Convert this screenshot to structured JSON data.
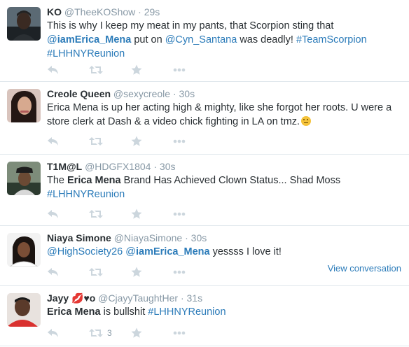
{
  "tweets": [
    {
      "fullname": "KO",
      "username": "@TheeKOShow",
      "time": "29s",
      "text_parts": [
        {
          "t": "This is why I keep my meat in my pants, that Scorpion sting that ",
          "s": "plain"
        },
        {
          "t": "@",
          "s": "link"
        },
        {
          "t": "iamErica_Mena",
          "s": "linkbold"
        },
        {
          "t": " put on ",
          "s": "plain"
        },
        {
          "t": "@Cyn_Santana",
          "s": "link"
        },
        {
          "t": " was deadly! ",
          "s": "plain"
        },
        {
          "t": "#TeamScorpion",
          "s": "link"
        },
        {
          "t": " ",
          "s": "plain"
        },
        {
          "t": "#LHHNYReunion",
          "s": "link"
        }
      ],
      "retweet_count": "",
      "view_conversation": ""
    },
    {
      "fullname": "Creole Queen",
      "username": "@sexycreole",
      "time": "30s",
      "text_parts": [
        {
          "t": "Erica Mena is up her acting high & mighty, like she forgot her roots. U were a store clerk at Dash & a video chick fighting in LA on tmz.",
          "s": "plain"
        }
      ],
      "retweet_count": "",
      "view_conversation": ""
    },
    {
      "fullname": "T1M@L",
      "username": "@HDGFX1804",
      "time": "30s",
      "text_parts": [
        {
          "t": "The ",
          "s": "plain"
        },
        {
          "t": "Erica Mena",
          "s": "bold"
        },
        {
          "t": " Brand Has Achieved Clown Status... Shad Moss ",
          "s": "plain"
        },
        {
          "t": "#LHHNYReunion",
          "s": "link"
        }
      ],
      "retweet_count": "",
      "view_conversation": ""
    },
    {
      "fullname": "Niaya Simone",
      "username": "@NiayaSimone",
      "time": "30s",
      "text_parts": [
        {
          "t": "@HighSociety26",
          "s": "link"
        },
        {
          "t": " ",
          "s": "plain"
        },
        {
          "t": "@",
          "s": "link"
        },
        {
          "t": "iamErica_Mena",
          "s": "linkbold"
        },
        {
          "t": " yessss I love it!",
          "s": "plain"
        }
      ],
      "retweet_count": "",
      "view_conversation": "View conversation"
    },
    {
      "fullname": "Jayy 💋♥o",
      "username": "@CjayyTaughtHer",
      "time": "31s",
      "text_parts": [
        {
          "t": "Erica Mena",
          "s": "bold"
        },
        {
          "t": " is bullshit ",
          "s": "plain"
        },
        {
          "t": "#LHHNYReunion",
          "s": "link"
        }
      ],
      "retweet_count": "3",
      "view_conversation": ""
    }
  ],
  "separator": "·",
  "icons": {
    "reply": "reply-icon",
    "retweet": "retweet-icon",
    "favorite": "star-icon",
    "more": "more-icon"
  },
  "colors": {
    "link": "#2b7bb9",
    "muted": "#8899a6",
    "action_icon": "#ccd6dd",
    "divider": "#e1e8ed"
  }
}
